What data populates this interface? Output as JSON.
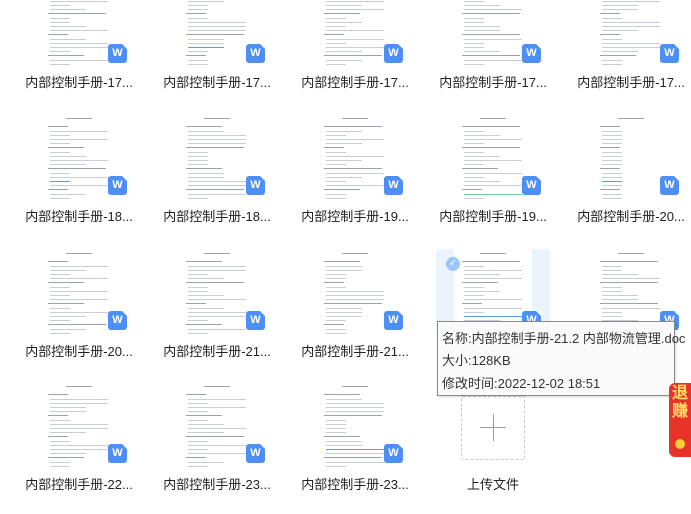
{
  "files": [
    {
      "name": "内部控制手册-17...",
      "type": "doc"
    },
    {
      "name": "内部控制手册-17...",
      "type": "doc"
    },
    {
      "name": "内部控制手册-17...",
      "type": "doc"
    },
    {
      "name": "内部控制手册-17...",
      "type": "doc"
    },
    {
      "name": "内部控制手册-17...",
      "type": "doc"
    },
    {
      "name": "内部控制手册-18...",
      "type": "doc"
    },
    {
      "name": "内部控制手册-18...",
      "type": "doc"
    },
    {
      "name": "内部控制手册-19...",
      "type": "doc"
    },
    {
      "name": "内部控制手册-19...",
      "type": "doc"
    },
    {
      "name": "内部控制手册-20...",
      "type": "doc"
    },
    {
      "name": "内部控制手册-20...",
      "type": "doc"
    },
    {
      "name": "内部控制手册-21...",
      "type": "doc"
    },
    {
      "name": "内部控制手册-21...",
      "type": "doc"
    },
    {
      "name": "",
      "type": "doc",
      "selected": true
    },
    {
      "name": "",
      "type": "doc"
    },
    {
      "name": "内部控制手册-22...",
      "type": "doc"
    },
    {
      "name": "内部控制手册-23...",
      "type": "doc"
    },
    {
      "name": "内部控制手册-23...",
      "type": "doc"
    }
  ],
  "file_icon_letter": "W",
  "selected_check": "✓",
  "upload": {
    "label": "上传文件"
  },
  "tooltip": {
    "name_line": "名称:内部控制手册-21.2 内部物流管理.doc",
    "size_line": "大小:128KB",
    "modified_line": "修改时间:2022-12-02 18:51"
  },
  "promo": {
    "text": "退赚"
  },
  "colors": {
    "accent": "#4e8ff5",
    "selected_bg": "#eaf3fe",
    "promo": "#e8332b"
  }
}
